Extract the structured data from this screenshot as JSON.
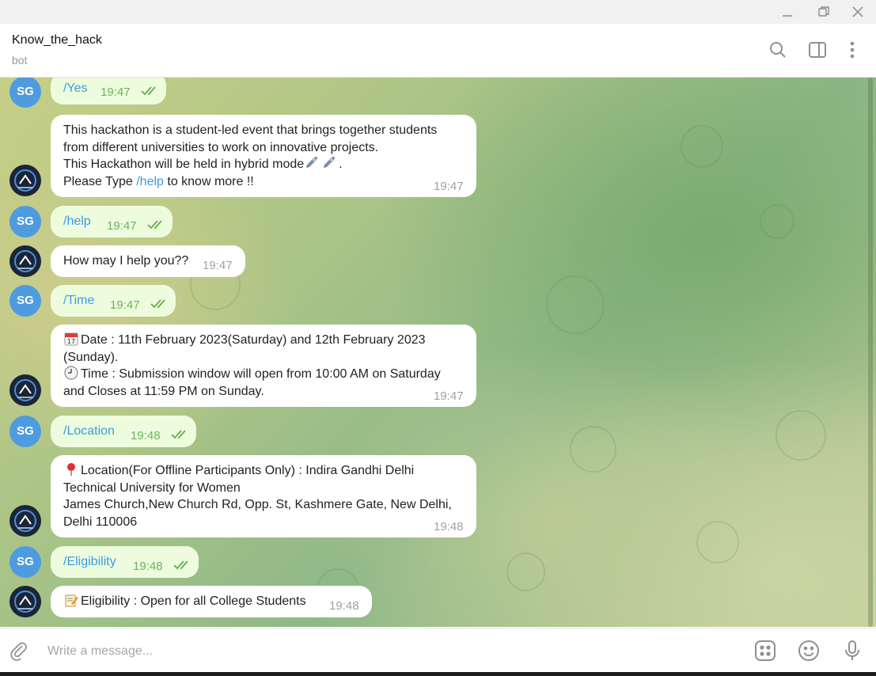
{
  "window": {
    "controls": [
      "minimize-icon",
      "restore-icon",
      "close-icon"
    ]
  },
  "header": {
    "title": "Know_the_hack",
    "subtitle": "bot",
    "icons": [
      "search-icon",
      "side-panel-icon",
      "more-vert-icon"
    ]
  },
  "user_avatar_initials": "SG",
  "messages": {
    "m1": {
      "text": "/Yes",
      "time": "19:47"
    },
    "m2": {
      "line1": "This hackathon is a student-led event that brings together students",
      "line2": "from different universities to work on innovative projects.",
      "line3": "This Hackathon will be held in hybrid mode",
      "line3_end": ".",
      "line4_pre": "Please Type ",
      "line4_link": "/help",
      "line4_post": " to know more !!",
      "time": "19:47"
    },
    "m3": {
      "text": "/help",
      "time": "19:47"
    },
    "m4": {
      "text": "How may I help you??",
      "time": "19:47"
    },
    "m5": {
      "text": "/Time",
      "time": "19:47"
    },
    "m6": {
      "line1": "Date : 11th February 2023(Saturday) and 12th February 2023",
      "line2": "(Sunday).",
      "line3": "Time : Submission window will open from 10:00 AM on Saturday",
      "line4": "and Closes at 11:59 PM on Sunday.",
      "time": "19:47"
    },
    "m7": {
      "text": "/Location",
      "time": "19:48"
    },
    "m8": {
      "line1": "Location(For Offline Participants Only) : Indira Gandhi Delhi",
      "line2": "Technical University for Women",
      "line3": "James Church,New Church Rd, Opp. St, Kashmere Gate, New Delhi,",
      "line4": "Delhi 110006",
      "time": "19:48"
    },
    "m9": {
      "text": "/Eligibility",
      "time": "19:48"
    },
    "m10": {
      "text": "Eligibility : Open for all College Students",
      "time": "19:48"
    }
  },
  "composer": {
    "placeholder": "Write a message...",
    "icons": [
      "paperclip-icon",
      "bot-commands-icon",
      "emoji-icon",
      "microphone-icon"
    ]
  }
}
